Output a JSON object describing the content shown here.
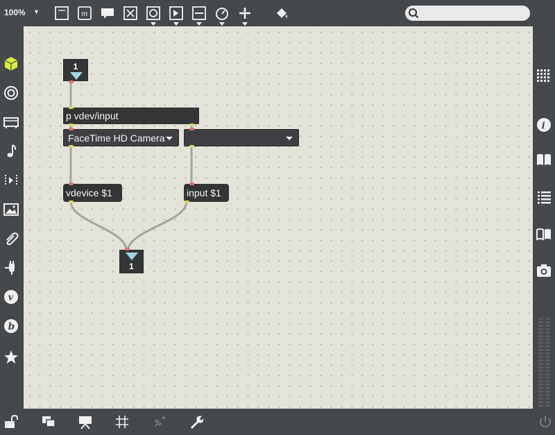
{
  "toolbar": {
    "zoom": "100%",
    "tools": [
      "new-object",
      "message",
      "comment",
      "toggle",
      "button",
      "number",
      "slider",
      "dial",
      "add",
      "paint"
    ]
  },
  "search": {
    "placeholder": "",
    "value": ""
  },
  "patch": {
    "inlet_number": "1",
    "outlet_number": "1",
    "subpatch": "p vdev/input",
    "menu_device": "FaceTime HD Camera",
    "menu_input": "",
    "msg_vdevice": "vdevice $1",
    "msg_input": "input $1"
  },
  "left_sidebar": [
    "cube-icon",
    "circle-icon",
    "tv-icon",
    "music-note-icon",
    "play-bracket-icon",
    "image-icon",
    "paperclip-icon",
    "plug-icon",
    "v-icon",
    "b-icon",
    "star-icon"
  ],
  "right_sidebar": [
    "grid-icon",
    "info-icon",
    "book-icon",
    "list-icon",
    "book-open-icon",
    "camera-icon"
  ],
  "bottom_bar": [
    "lock-icon",
    "windows-icon",
    "presentation-icon",
    "grid-hash-icon",
    "pin-add-icon",
    "wrench-icon",
    "power-icon"
  ],
  "colors": {
    "canvas": "#e4e3da",
    "chrome": "#46494c",
    "object": "#333537",
    "accent": "#d8ef3a"
  }
}
